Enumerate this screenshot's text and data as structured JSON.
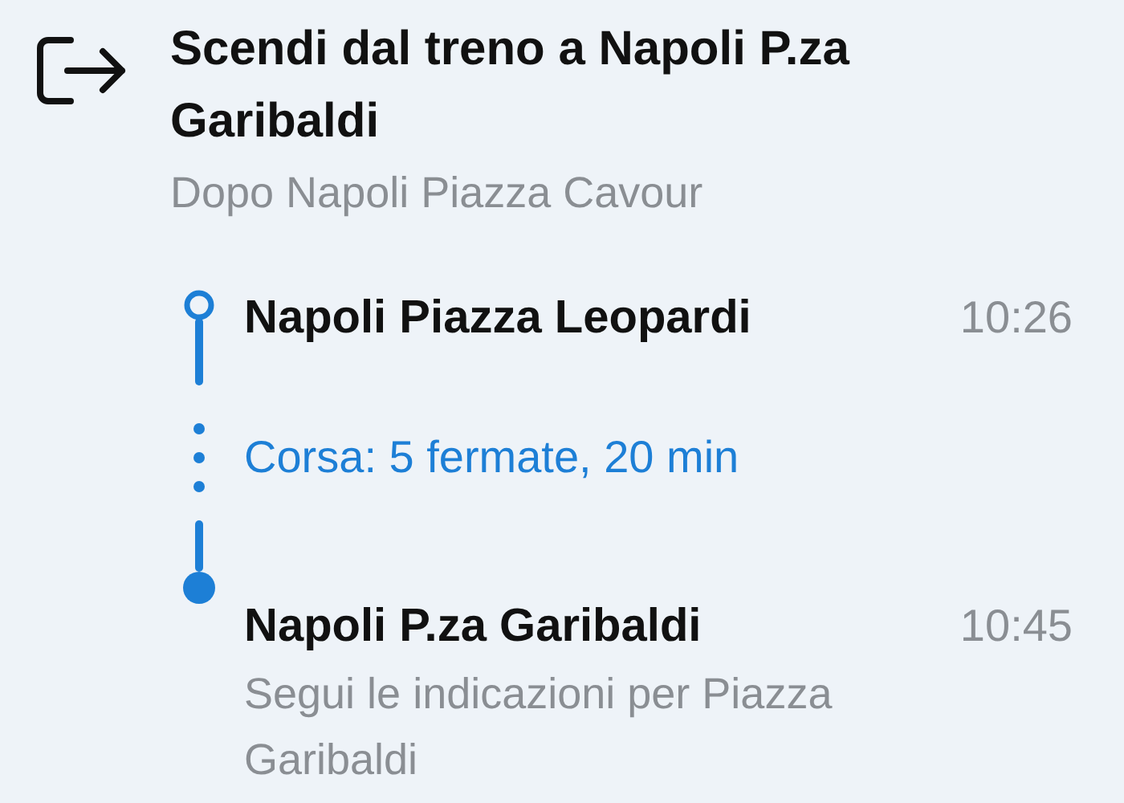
{
  "step": {
    "title": "Scendi dal treno a Napoli P.za Garibaldi",
    "subtitle": "Dopo Napoli Piazza Cavour"
  },
  "stops": [
    {
      "kind": "start",
      "name": "Napoli Piazza Leopardi",
      "time": "10:26"
    },
    {
      "kind": "end",
      "name": "Napoli P.za Garibaldi",
      "time": "10:45",
      "note": "Segui le indicazioni per Piazza Garibaldi"
    }
  ],
  "ride": {
    "summary": "Corsa: 5 fermate, 20 min"
  }
}
